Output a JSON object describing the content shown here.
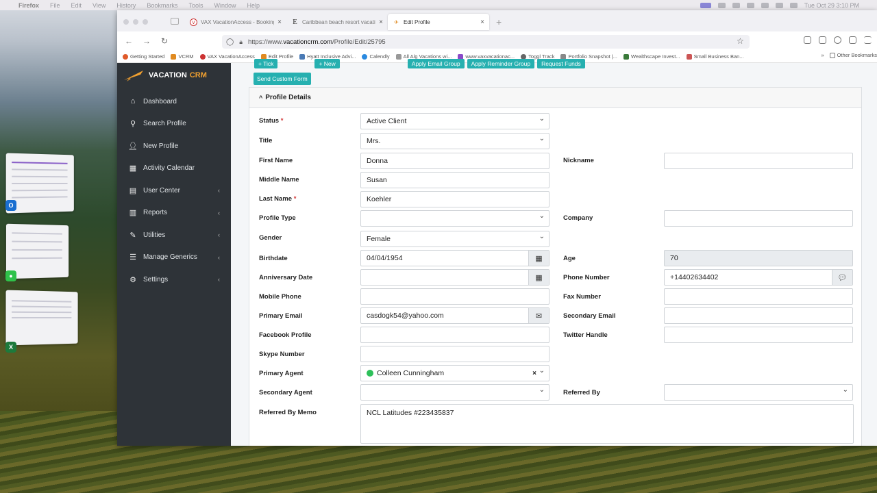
{
  "menubar": {
    "app": "Firefox",
    "menus": [
      "File",
      "Edit",
      "View",
      "History",
      "Bookmarks",
      "Tools",
      "Window",
      "Help"
    ],
    "datetime": "Tue Oct 29  3:10 PM"
  },
  "browser": {
    "tabs": [
      {
        "title": "VAX VacationAccess - Booking"
      },
      {
        "title": "Caribbean beach resort vacatio"
      },
      {
        "title": "Edit Profile"
      }
    ],
    "url_prefix": "https://www.",
    "url_domain": "vacationcrm.com",
    "url_path": "/Profile/Edit/25795",
    "bookmarks": [
      "Getting Started",
      "VCRM",
      "VAX VacationAccess",
      "Edit Profile",
      "Hyatt Inclusive Advi...",
      "Calendly",
      "All Alg Vacations wi...",
      "www.vaxvacationac...",
      "Toggl Track",
      "Portfolio Snapshot |...",
      "Wealthscape Invest...",
      "Small Business Ban..."
    ],
    "other_bookmarks": "Other Bookmarks"
  },
  "sidebar": {
    "brand_a": "VACATION",
    "brand_b": "CRM",
    "items": [
      {
        "label": "Dashboard",
        "icon": "home-icon"
      },
      {
        "label": "Search Profile",
        "icon": "search-icon"
      },
      {
        "label": "New Profile",
        "icon": "user-plus-icon"
      },
      {
        "label": "Activity Calendar",
        "icon": "calendar-icon"
      },
      {
        "label": "User Center",
        "icon": "folder-icon"
      },
      {
        "label": "Reports",
        "icon": "report-icon"
      },
      {
        "label": "Utilities",
        "icon": "tools-icon"
      },
      {
        "label": "Manage Generics",
        "icon": "sliders-icon"
      },
      {
        "label": "Settings",
        "icon": "gear-icon"
      }
    ]
  },
  "toolbar": {
    "buttons": [
      "+ Tick",
      "+ New",
      "Apply Email Group",
      "Apply Reminder Group",
      "Request Funds"
    ],
    "send_custom_form": "Send Custom Form"
  },
  "profile": {
    "section_title": "Profile Details",
    "status": {
      "label": "Status",
      "value": "Active Client"
    },
    "title": {
      "label": "Title",
      "value": "Mrs."
    },
    "first_name": {
      "label": "First Name",
      "value": "Donna"
    },
    "nickname": {
      "label": "Nickname",
      "value": ""
    },
    "middle_name": {
      "label": "Middle Name",
      "value": "Susan"
    },
    "last_name": {
      "label": "Last Name",
      "value": "Koehler"
    },
    "profile_type": {
      "label": "Profile Type",
      "value": ""
    },
    "company": {
      "label": "Company",
      "value": ""
    },
    "gender": {
      "label": "Gender",
      "value": "Female"
    },
    "birthdate": {
      "label": "Birthdate",
      "value": "04/04/1954"
    },
    "age": {
      "label": "Age",
      "value": "70"
    },
    "anniversary": {
      "label": "Anniversary Date",
      "value": ""
    },
    "phone": {
      "label": "Phone Number",
      "value": "+14402634402"
    },
    "mobile": {
      "label": "Mobile Phone",
      "value": ""
    },
    "fax": {
      "label": "Fax Number",
      "value": ""
    },
    "primary_email": {
      "label": "Primary Email",
      "value": "casdogk54@yahoo.com"
    },
    "secondary_email": {
      "label": "Secondary Email",
      "value": ""
    },
    "facebook": {
      "label": "Facebook Profile",
      "value": ""
    },
    "twitter": {
      "label": "Twitter Handle",
      "value": ""
    },
    "skype": {
      "label": "Skype Number",
      "value": ""
    },
    "primary_agent": {
      "label": "Primary Agent",
      "value": "Colleen Cunningham"
    },
    "secondary_agent": {
      "label": "Secondary Agent",
      "value": ""
    },
    "referred_by": {
      "label": "Referred By",
      "value": ""
    },
    "referred_memo": {
      "label": "Referred By Memo",
      "value": "NCL Latitudes #223435837"
    }
  }
}
